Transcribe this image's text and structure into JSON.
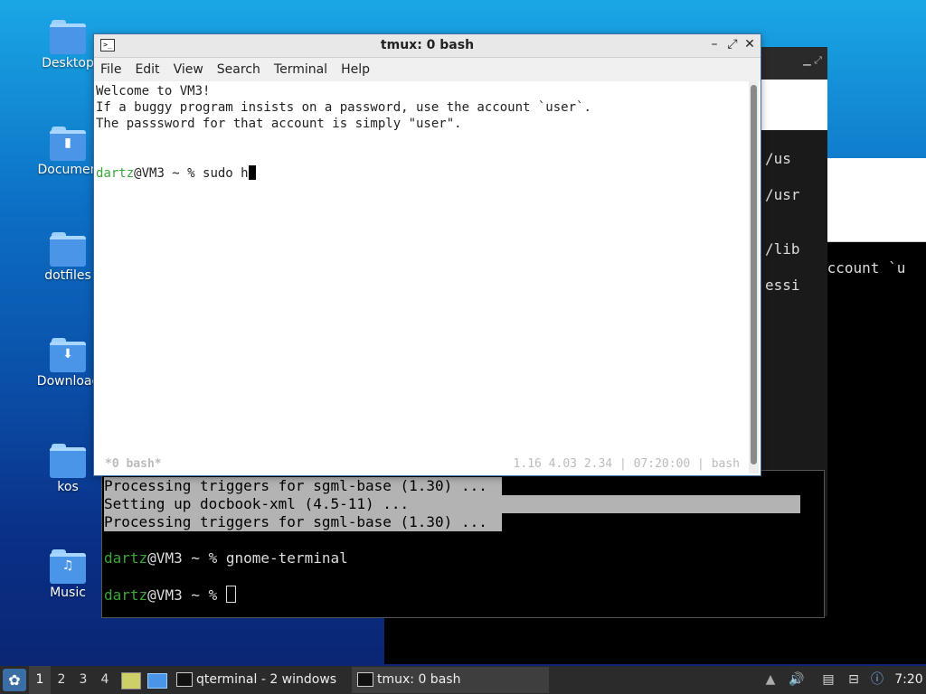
{
  "desktop": {
    "icons": [
      {
        "label": "Desktop"
      },
      {
        "label": "Documen"
      },
      {
        "label": "dotfiles"
      },
      {
        "label": "Downloac"
      },
      {
        "label": "kos"
      },
      {
        "label": "Music"
      }
    ]
  },
  "back_windows": {
    "right_fragments": [
      "/us",
      "/usr",
      "/lib",
      "essi"
    ],
    "far_fragment": "account `u"
  },
  "qterminal": {
    "lines": [
      "Processing triggers for sgml-base (1.30) ...",
      "Setting up docbook-xml (4.5-11) ...",
      "Processing triggers for sgml-base (1.30) ...",
      "",
      "dartz@VM3 ~ % gnome-terminal",
      "",
      "dartz@VM3 ~ % "
    ],
    "prompt_user": "dartz",
    "prompt_rest_1": "@VM3 ~ % gnome-terminal",
    "prompt_rest_2": "@VM3 ~ % "
  },
  "main_window": {
    "title": "tmux: 0 bash",
    "menu": [
      "File",
      "Edit",
      "View",
      "Search",
      "Terminal",
      "Help"
    ],
    "lines": [
      "Welcome to VM3!",
      "If a buggy program insists on a password, use the account `user`.",
      "The passsword for that account is simply \"user\"."
    ],
    "prompt_user": "dartz",
    "prompt_rest": "@VM3 ~ % sudo h",
    "status_left": "*0 bash*",
    "status_right": "1.16 4.03 2.34 | 07:20:00 | bash"
  },
  "taskbar": {
    "workspaces": [
      "1",
      "2",
      "3",
      "4"
    ],
    "tasks": [
      "qterminal - 2 windows",
      "tmux: 0 bash"
    ],
    "clock": "7:20"
  },
  "colors": {
    "prompt_green": "#3aa63a",
    "taskbar_bg": "#2b2b2b"
  }
}
